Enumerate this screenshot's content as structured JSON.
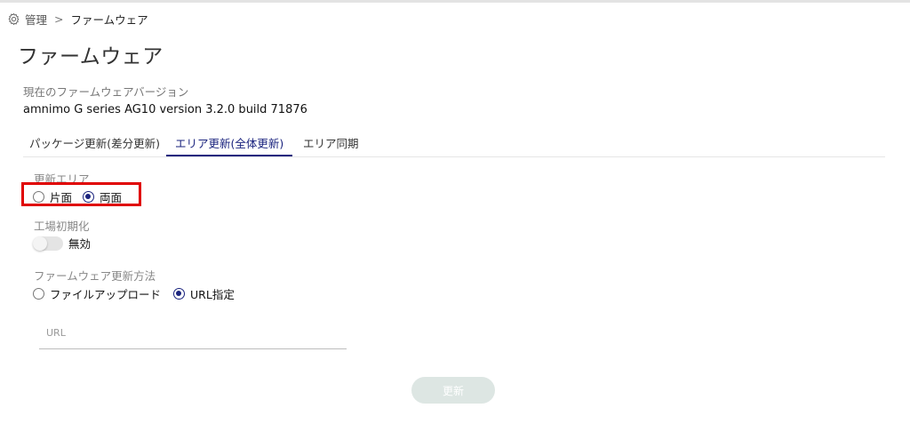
{
  "breadcrumb": {
    "root": "管理",
    "separator": ">",
    "current": "ファームウェア"
  },
  "page_title": "ファームウェア",
  "version": {
    "label": "現在のファームウェアバージョン",
    "value": "amnimo G series AG10 version 3.2.0 build 71876"
  },
  "tabs": [
    {
      "label": "パッケージ更新(差分更新)",
      "active": false
    },
    {
      "label": "エリア更新(全体更新)",
      "active": true
    },
    {
      "label": "エリア同期",
      "active": false
    }
  ],
  "update_area": {
    "label": "更新エリア",
    "options": [
      {
        "label": "片面",
        "checked": false
      },
      {
        "label": "両面",
        "checked": true
      }
    ]
  },
  "factory_reset": {
    "label": "工場初期化",
    "state_label": "無効",
    "enabled": false
  },
  "update_method": {
    "label": "ファームウェア更新方法",
    "options": [
      {
        "label": "ファイルアップロード",
        "checked": false
      },
      {
        "label": "URL指定",
        "checked": true
      }
    ]
  },
  "url_input": {
    "placeholder": "URL",
    "value": ""
  },
  "update_button": {
    "label": "更新"
  },
  "colors": {
    "accent": "#1a237e",
    "highlight": "#e00000",
    "button_disabled": "#dde6e3"
  },
  "icons": {
    "settings": "gear-icon"
  }
}
